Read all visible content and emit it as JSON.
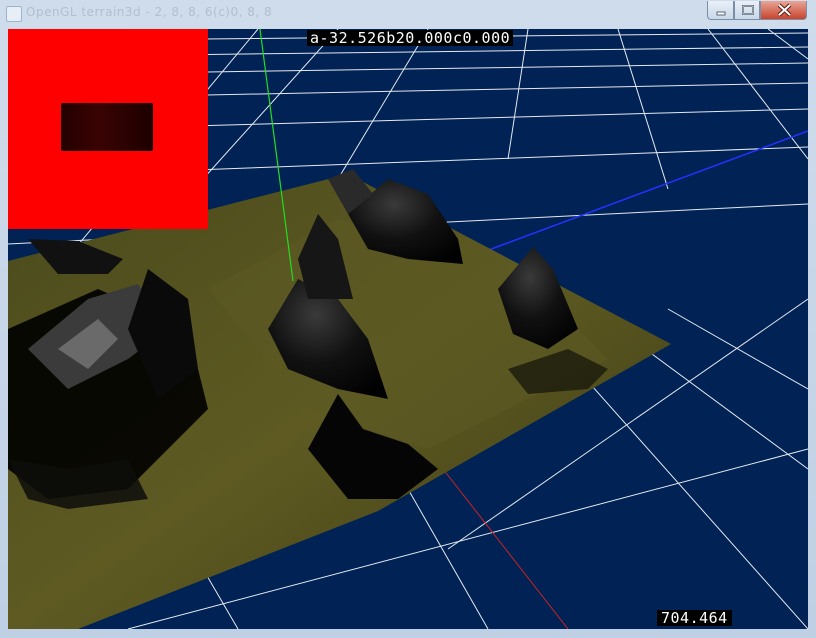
{
  "window": {
    "title": "OpenGL terrain3d - 2, 8, 8, 6(c)0, 8, 8"
  },
  "hud": {
    "camera_readout": "a-32.526b20.000c0.000",
    "fps_readout": "704.464"
  },
  "colors": {
    "background": "#002255",
    "grid": "#ffffff",
    "x_axis": "#cc2222",
    "y_axis": "#22dd22",
    "z_axis": "#2233ff",
    "terrain": "#5a5a20",
    "preview": "#ff0000"
  },
  "icons": {
    "minimize": "minimize-icon",
    "maximize": "maximize-icon",
    "close": "close-icon"
  }
}
